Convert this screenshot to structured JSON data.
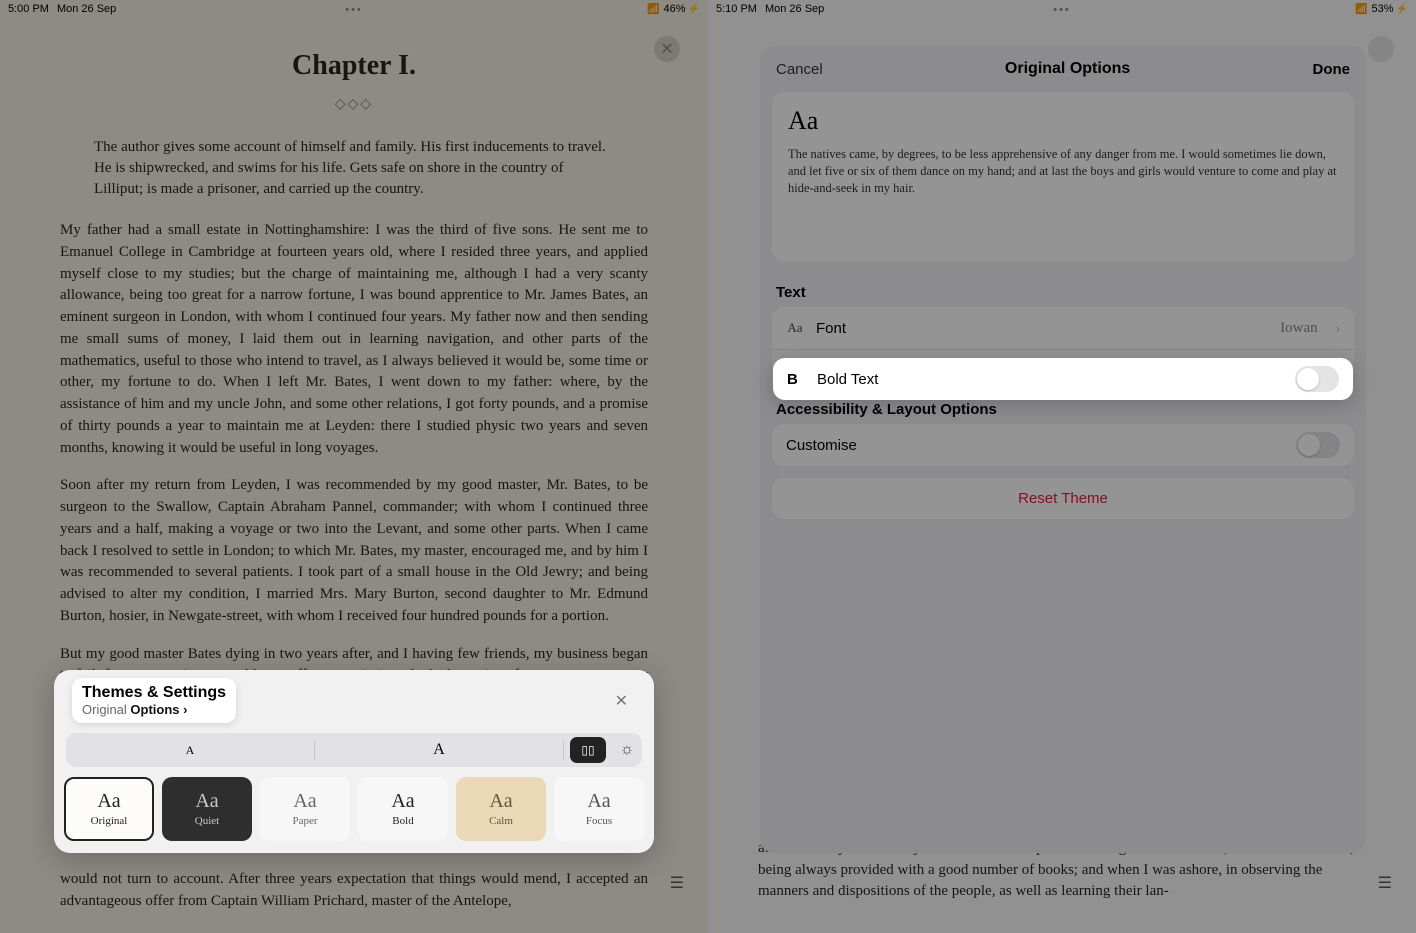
{
  "left": {
    "status": {
      "time": "5:00 PM",
      "date": "Mon 26 Sep",
      "battery": "46%"
    },
    "chapter_title": "Chapter I.",
    "ornament": "◇◇◇",
    "summary": "The author gives some account of himself and family.  His first inducements to travel.  He is shipwrecked, and swims for his life.  Gets safe on shore in the country of Lilliput; is made a prisoner, and carried up the country.",
    "p1": "My father had a small estate in Nottinghamshire: I was the third of five sons.  He sent me to Emanuel College in Cambridge at fourteen years old, where I resided three years, and applied myself close to my studies; but the charge of maintaining me, although I had a very scanty allowance, being too great for a narrow fortune, I was bound apprentice to Mr. James Bates, an eminent surgeon in London, with whom I continued four years.  My father now and then sending me small sums of money, I laid them out in learning navigation, and other parts of the mathematics, useful to those who intend to travel, as I always believed it would be, some time or other, my fortune to do.  When I left Mr. Bates, I went down to my father: where, by the assistance of him and my uncle John, and some other relations, I got forty pounds, and a promise of thirty pounds a year to maintain me at Leyden: there I studied physic two years and seven months, knowing it would be useful in long voyages.",
    "p2": "Soon after my return from Leyden, I was recommended by my good master, Mr. Bates, to be surgeon to the Swallow, Captain Abraham Pannel, commander; with whom I continued three years and a half, making a voyage or two into the Levant, and some other parts. When I came back I resolved to settle in London; to which Mr. Bates, my master, encouraged me, and by him I was recommended to several patients.  I took part of a small house in the Old Jewry; and being advised to alter my condition, I married Mrs. Mary Burton, second daughter to Mr. Edmund Burton, hosier, in Newgate-street, with whom I received four hundred pounds for a portion.",
    "p3": "But my good master Bates dying in two years after, and I having few friends, my business began to fail; for my conscience would not suffer me to imitate the bad practice of too many among my brethren.  Having therefore consulted with my wife, and some of my",
    "p4": "would not turn to account.  After three years expectation that things would mend, I accepted an advantageous offer from Captain William Prichard, master of the Antelope,",
    "themes": {
      "title": "Themes & Settings",
      "sub_prefix": "Original ",
      "sub_link": "Options",
      "font_small": "A",
      "font_big": "A",
      "items": [
        {
          "aa": "Aa",
          "name": "Original"
        },
        {
          "aa": "Aa",
          "name": "Quiet"
        },
        {
          "aa": "Aa",
          "name": "Paper"
        },
        {
          "aa": "Aa",
          "name": "Bold"
        },
        {
          "aa": "Aa",
          "name": "Calm"
        },
        {
          "aa": "Aa",
          "name": "Focus"
        }
      ]
    }
  },
  "right": {
    "status": {
      "time": "5:10 PM",
      "date": "Mon 26 Sep",
      "battery": "53%"
    },
    "panel": {
      "cancel": "Cancel",
      "title": "Original Options",
      "done": "Done",
      "preview_aa": "Aa",
      "preview_para": "The natives came, by degrees, to be less apprehensive of any danger from me.  I would sometimes lie down, and let five or six of them dance on my hand; and at last the boys and girls would venture to come and play at hide-and-seek in my hair.",
      "text_section": "Text",
      "font_label": "Font",
      "font_value": "Iowan",
      "bold_label": "Bold Text",
      "access_section": "Accessibility & Layout Options",
      "customise_label": "Customise",
      "reset_label": "Reset Theme"
    },
    "bg_para": "addition to my fortune.  My hours of leisure I spent in reading the best authors, ancient and modern, being always provided with a good number of books; and when I was ashore, in observing the manners and dispositions of the people, as well as learning their lan-"
  }
}
